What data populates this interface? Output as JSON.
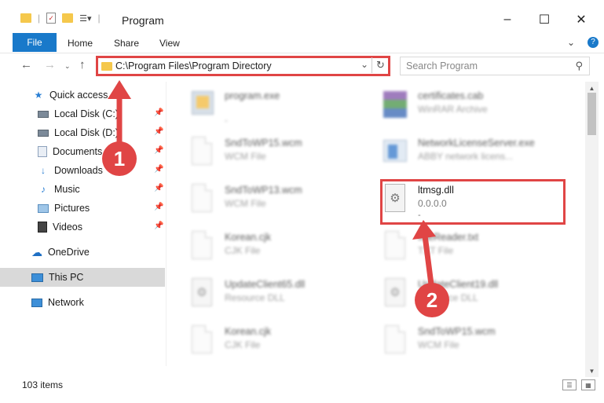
{
  "window": {
    "title": "Program",
    "minimize": "–",
    "maximize": "☐",
    "close": "✕"
  },
  "ribbon": {
    "file": "File",
    "tabs": [
      "Home",
      "Share",
      "View"
    ],
    "collapse": "⌄",
    "help": "?"
  },
  "address": {
    "path": "C:\\Program Files\\Program Directory",
    "search_placeholder": "Search Program"
  },
  "sidebar": {
    "items": [
      {
        "label": "Quick access",
        "icon": "star-icon",
        "pinned": false
      },
      {
        "label": "Local Disk (C:)",
        "icon": "drive-icon",
        "pinned": true
      },
      {
        "label": "Local Disk (D:)",
        "icon": "drive-icon",
        "pinned": true
      },
      {
        "label": "Documents",
        "icon": "documents-icon",
        "pinned": true
      },
      {
        "label": "Downloads",
        "icon": "downloads-icon",
        "pinned": true
      },
      {
        "label": "Music",
        "icon": "music-icon",
        "pinned": true
      },
      {
        "label": "Pictures",
        "icon": "pictures-icon",
        "pinned": true
      },
      {
        "label": "Videos",
        "icon": "videos-icon",
        "pinned": true
      },
      {
        "label": "OneDrive",
        "icon": "onedrive-icon",
        "pinned": false
      },
      {
        "label": "This PC",
        "icon": "computer-icon",
        "pinned": false
      },
      {
        "label": "Network",
        "icon": "network-icon",
        "pinned": false
      }
    ]
  },
  "files": [
    {
      "name": "program.exe",
      "type": "",
      "extra": "-",
      "icon": "exe-icon"
    },
    {
      "name": "certificates.cab",
      "type": "WinRAR Archive",
      "extra": "",
      "icon": "archive-icon"
    },
    {
      "name": "SndToWP15.wcm",
      "type": "WCM File",
      "extra": "",
      "icon": "file-icon"
    },
    {
      "name": "NetworkLicenseServer.exe",
      "type": "ABBY network licens...",
      "extra": "",
      "icon": "exe-icon"
    },
    {
      "name": "SndToWP13.wcm",
      "type": "WCM File",
      "extra": "",
      "icon": "file-icon"
    },
    {
      "name": "ltmsg.dll",
      "type": "0.0.0.0",
      "extra": "-",
      "icon": "dll-gear-icon"
    },
    {
      "name": "Korean.cjk",
      "type": "CJK File",
      "extra": "",
      "icon": "file-icon"
    },
    {
      "name": "fineReader.txt",
      "type": "TXT File",
      "extra": "",
      "icon": "file-icon"
    },
    {
      "name": "UpdateClient65.dll",
      "type": "Resource DLL",
      "extra": "",
      "icon": "dll-gear-icon"
    },
    {
      "name": "UpdateClient19.dll",
      "type": "Resource DLL",
      "extra": "",
      "icon": "dll-gear-icon"
    },
    {
      "name": "Korean.cjk",
      "type": "CJK File",
      "extra": "",
      "icon": "file-icon"
    },
    {
      "name": "SndToWP15.wcm",
      "type": "WCM File",
      "extra": "",
      "icon": "file-icon"
    }
  ],
  "status": {
    "count": "103 items"
  },
  "callouts": [
    "1",
    "2"
  ],
  "colors": {
    "accent": "#1979ca",
    "highlight": "#e04545"
  }
}
